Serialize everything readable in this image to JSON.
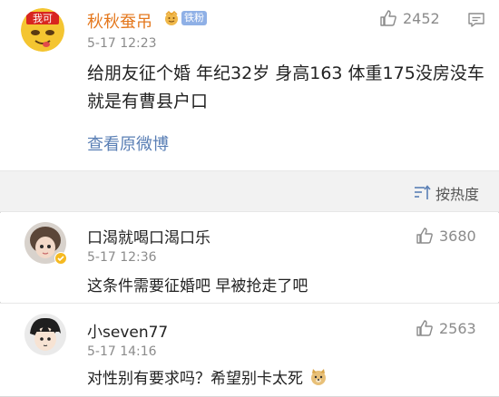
{
  "post": {
    "author": "秋秋蚕吊",
    "avatar_text": "我可",
    "fan_badge": "铁粉",
    "time": "5-17 12:23",
    "likes": "2452",
    "text": "给朋友征个婚 年纪32岁 身高163 体重175没房没车 就是有曹县户口",
    "view_original": "查看原微博"
  },
  "sort": {
    "label": "按热度"
  },
  "comments": [
    {
      "author": "口渴就喝口渴口乐",
      "time": "5-17 12:36",
      "likes": "3680",
      "text": "这条件需要征婚吧 早被抢走了吧"
    },
    {
      "author": "小seven77",
      "time": "5-17 14:16",
      "likes": "2563",
      "text": "对性别有要求吗？希望别卡太死"
    }
  ],
  "colors": {
    "author_orange": "#e4781e",
    "link_blue": "#5a7fb5",
    "muted": "#8b8b8b"
  }
}
